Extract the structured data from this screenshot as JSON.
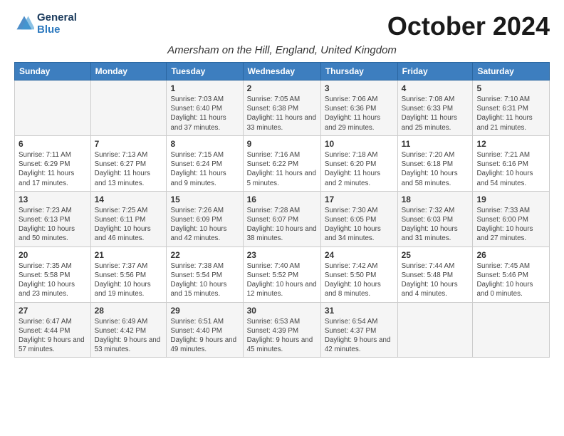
{
  "header": {
    "title": "October 2024",
    "subtitle": "Amersham on the Hill, England, United Kingdom",
    "logo_line1": "General",
    "logo_line2": "Blue"
  },
  "weekdays": [
    "Sunday",
    "Monday",
    "Tuesday",
    "Wednesday",
    "Thursday",
    "Friday",
    "Saturday"
  ],
  "weeks": [
    [
      {
        "day": "",
        "info": ""
      },
      {
        "day": "",
        "info": ""
      },
      {
        "day": "1",
        "info": "Sunrise: 7:03 AM\nSunset: 6:40 PM\nDaylight: 11 hours and 37 minutes."
      },
      {
        "day": "2",
        "info": "Sunrise: 7:05 AM\nSunset: 6:38 PM\nDaylight: 11 hours and 33 minutes."
      },
      {
        "day": "3",
        "info": "Sunrise: 7:06 AM\nSunset: 6:36 PM\nDaylight: 11 hours and 29 minutes."
      },
      {
        "day": "4",
        "info": "Sunrise: 7:08 AM\nSunset: 6:33 PM\nDaylight: 11 hours and 25 minutes."
      },
      {
        "day": "5",
        "info": "Sunrise: 7:10 AM\nSunset: 6:31 PM\nDaylight: 11 hours and 21 minutes."
      }
    ],
    [
      {
        "day": "6",
        "info": "Sunrise: 7:11 AM\nSunset: 6:29 PM\nDaylight: 11 hours and 17 minutes."
      },
      {
        "day": "7",
        "info": "Sunrise: 7:13 AM\nSunset: 6:27 PM\nDaylight: 11 hours and 13 minutes."
      },
      {
        "day": "8",
        "info": "Sunrise: 7:15 AM\nSunset: 6:24 PM\nDaylight: 11 hours and 9 minutes."
      },
      {
        "day": "9",
        "info": "Sunrise: 7:16 AM\nSunset: 6:22 PM\nDaylight: 11 hours and 5 minutes."
      },
      {
        "day": "10",
        "info": "Sunrise: 7:18 AM\nSunset: 6:20 PM\nDaylight: 11 hours and 2 minutes."
      },
      {
        "day": "11",
        "info": "Sunrise: 7:20 AM\nSunset: 6:18 PM\nDaylight: 10 hours and 58 minutes."
      },
      {
        "day": "12",
        "info": "Sunrise: 7:21 AM\nSunset: 6:16 PM\nDaylight: 10 hours and 54 minutes."
      }
    ],
    [
      {
        "day": "13",
        "info": "Sunrise: 7:23 AM\nSunset: 6:13 PM\nDaylight: 10 hours and 50 minutes."
      },
      {
        "day": "14",
        "info": "Sunrise: 7:25 AM\nSunset: 6:11 PM\nDaylight: 10 hours and 46 minutes."
      },
      {
        "day": "15",
        "info": "Sunrise: 7:26 AM\nSunset: 6:09 PM\nDaylight: 10 hours and 42 minutes."
      },
      {
        "day": "16",
        "info": "Sunrise: 7:28 AM\nSunset: 6:07 PM\nDaylight: 10 hours and 38 minutes."
      },
      {
        "day": "17",
        "info": "Sunrise: 7:30 AM\nSunset: 6:05 PM\nDaylight: 10 hours and 34 minutes."
      },
      {
        "day": "18",
        "info": "Sunrise: 7:32 AM\nSunset: 6:03 PM\nDaylight: 10 hours and 31 minutes."
      },
      {
        "day": "19",
        "info": "Sunrise: 7:33 AM\nSunset: 6:00 PM\nDaylight: 10 hours and 27 minutes."
      }
    ],
    [
      {
        "day": "20",
        "info": "Sunrise: 7:35 AM\nSunset: 5:58 PM\nDaylight: 10 hours and 23 minutes."
      },
      {
        "day": "21",
        "info": "Sunrise: 7:37 AM\nSunset: 5:56 PM\nDaylight: 10 hours and 19 minutes."
      },
      {
        "day": "22",
        "info": "Sunrise: 7:38 AM\nSunset: 5:54 PM\nDaylight: 10 hours and 15 minutes."
      },
      {
        "day": "23",
        "info": "Sunrise: 7:40 AM\nSunset: 5:52 PM\nDaylight: 10 hours and 12 minutes."
      },
      {
        "day": "24",
        "info": "Sunrise: 7:42 AM\nSunset: 5:50 PM\nDaylight: 10 hours and 8 minutes."
      },
      {
        "day": "25",
        "info": "Sunrise: 7:44 AM\nSunset: 5:48 PM\nDaylight: 10 hours and 4 minutes."
      },
      {
        "day": "26",
        "info": "Sunrise: 7:45 AM\nSunset: 5:46 PM\nDaylight: 10 hours and 0 minutes."
      }
    ],
    [
      {
        "day": "27",
        "info": "Sunrise: 6:47 AM\nSunset: 4:44 PM\nDaylight: 9 hours and 57 minutes."
      },
      {
        "day": "28",
        "info": "Sunrise: 6:49 AM\nSunset: 4:42 PM\nDaylight: 9 hours and 53 minutes."
      },
      {
        "day": "29",
        "info": "Sunrise: 6:51 AM\nSunset: 4:40 PM\nDaylight: 9 hours and 49 minutes."
      },
      {
        "day": "30",
        "info": "Sunrise: 6:53 AM\nSunset: 4:39 PM\nDaylight: 9 hours and 45 minutes."
      },
      {
        "day": "31",
        "info": "Sunrise: 6:54 AM\nSunset: 4:37 PM\nDaylight: 9 hours and 42 minutes."
      },
      {
        "day": "",
        "info": ""
      },
      {
        "day": "",
        "info": ""
      }
    ]
  ]
}
